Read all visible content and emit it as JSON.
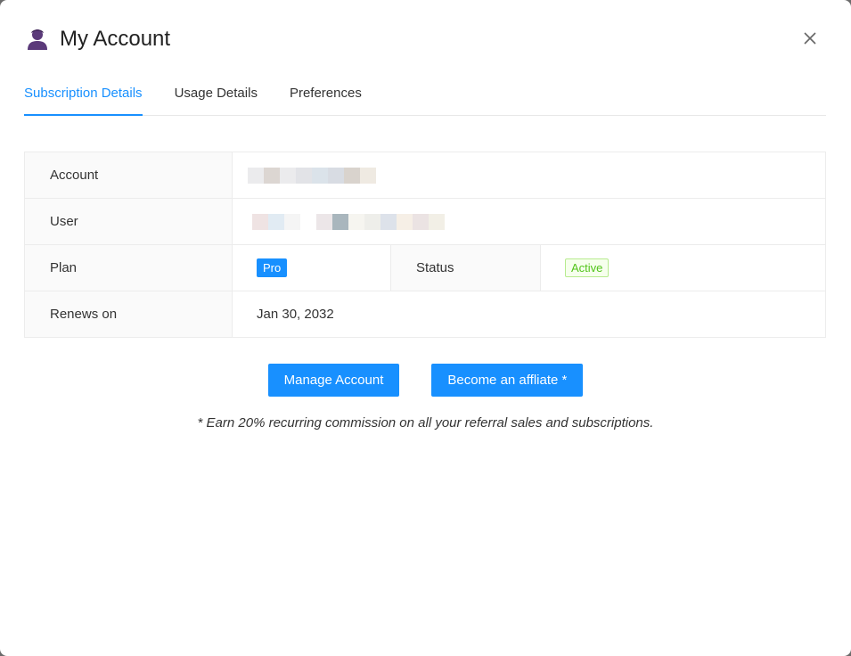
{
  "modal": {
    "title": "My Account",
    "close_icon": "close-icon",
    "user_icon": "user-icon"
  },
  "tabs": [
    {
      "label": "Subscription Details",
      "active": true
    },
    {
      "label": "Usage Details",
      "active": false
    },
    {
      "label": "Preferences",
      "active": false
    }
  ],
  "details": {
    "account": {
      "label": "Account",
      "value": "[redacted]"
    },
    "user": {
      "label": "User",
      "value": "[redacted]"
    },
    "plan": {
      "label": "Plan",
      "value": "Pro"
    },
    "status": {
      "label": "Status",
      "value": "Active"
    },
    "renews": {
      "label": "Renews on",
      "value": "Jan 30, 2032"
    }
  },
  "actions": {
    "manage_label": "Manage Account",
    "affiliate_label": "Become an affliate *"
  },
  "note": "* Earn 20% recurring commission on all your referral sales and subscriptions.",
  "colors": {
    "accent": "#1890ff",
    "status_active": "#52c41a",
    "user_icon": "#5b3a7a"
  }
}
